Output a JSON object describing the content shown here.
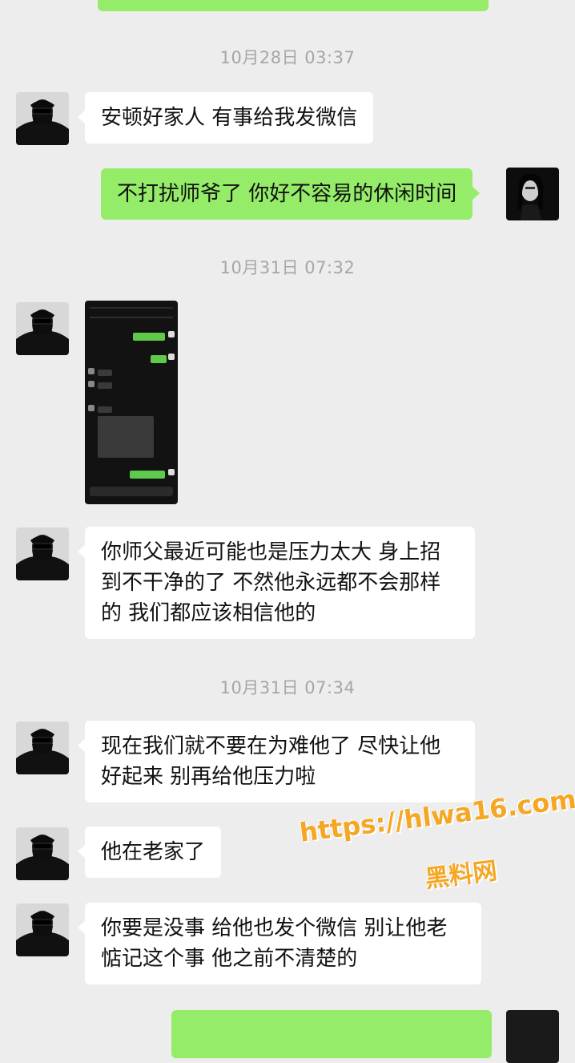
{
  "colors": {
    "background": "#ededed",
    "sent_bubble": "#95ec69",
    "received_bubble": "#ffffff",
    "timestamp": "#a6a6a6",
    "watermark": "#f5a623"
  },
  "timestamps": [
    "10月28日 03:37",
    "10月31日 07:32",
    "10月31日 07:34"
  ],
  "messages": [
    {
      "side": "left",
      "text": "安顿好家人 有事给我发微信"
    },
    {
      "side": "right",
      "text": "不打扰师爷了 你好不容易的休闲时间"
    },
    {
      "side": "left",
      "type": "image",
      "icon": "chat-screenshot-image"
    },
    {
      "side": "left",
      "line1": "你师父最近可能也是压力太大 身上招",
      "line2": "到不干净的了 不然他永远都不会那样",
      "line3": "的 我们都应该相信他的"
    },
    {
      "side": "left",
      "line1": "现在我们就不要在为难他了 尽快让他",
      "line2": "好起来 别再给他压力啦"
    },
    {
      "side": "left",
      "text": "他在老家了"
    },
    {
      "side": "left",
      "line1": "你要是没事 给他也发个微信 别让他老",
      "line2": "惦记这个事 他之前不清楚的"
    }
  ],
  "watermark": {
    "url": "https://hlwa16.com",
    "name": "黑料网"
  },
  "avatars": {
    "left": "masked-man-avatar",
    "right": "woman-portrait-avatar"
  }
}
